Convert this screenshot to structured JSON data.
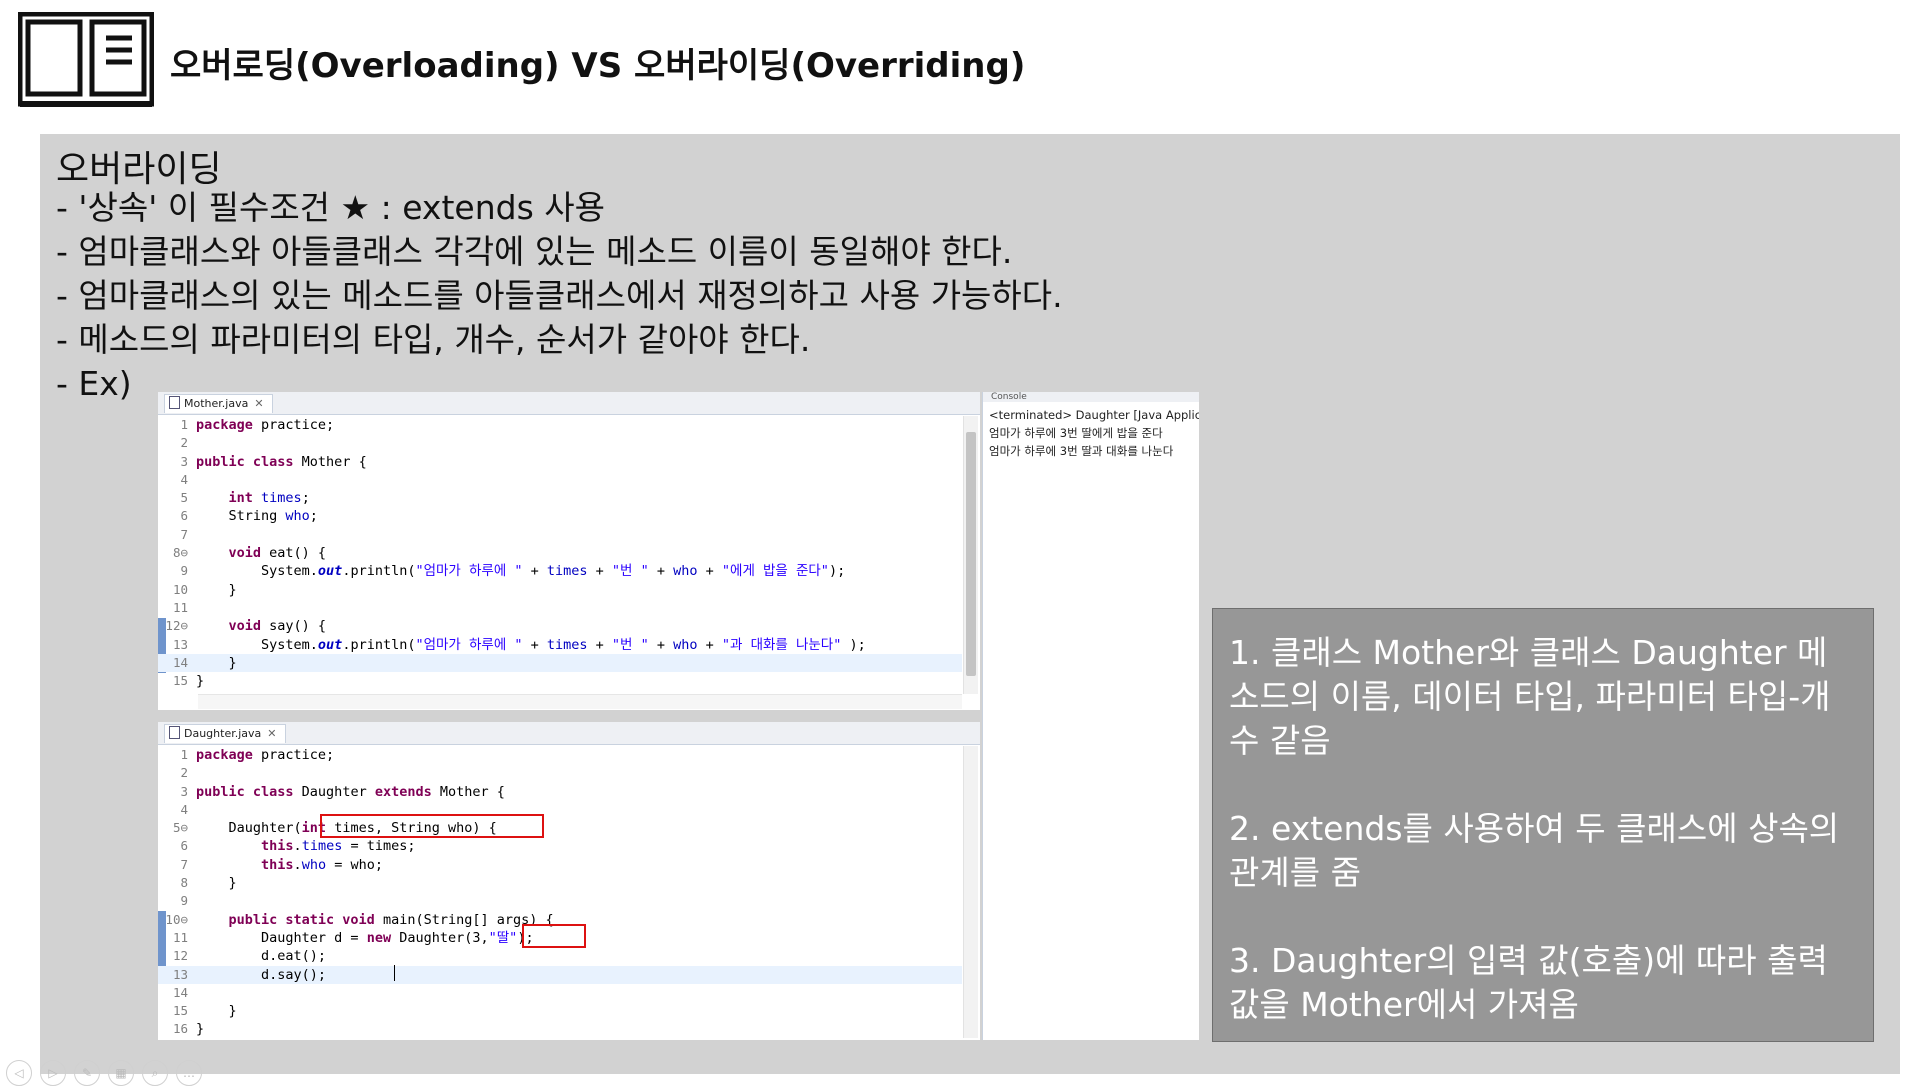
{
  "slide": {
    "title": "오버로딩(Overloading) VS 오버라이딩(Overriding)",
    "heading": "오버라이딩",
    "bullets": [
      "-  '상속' 이 필수조건 ★ : extends 사용",
      "- 엄마클래스와 아들클래스 각각에 있는 메소드 이름이 동일해야 한다.",
      "- 엄마클래스의 있는 메소드를 아들클래스에서 재정의하고 사용 가능하다.",
      "- 메소드의 파라미터의 타입, 개수, 순서가 같아야 한다.",
      "- Ex)"
    ]
  },
  "mother_editor": {
    "tab_label": "Mother.java",
    "lines": [
      {
        "n": "1",
        "html": "<span class=\"kw\">package</span> practice;"
      },
      {
        "n": "2",
        "html": ""
      },
      {
        "n": "3",
        "html": "<span class=\"kw\">public class</span> Mother {"
      },
      {
        "n": "4",
        "html": ""
      },
      {
        "n": "5",
        "html": "    <span class=\"kw\">int</span> <span class=\"fld\">times</span>;"
      },
      {
        "n": "6",
        "html": "    String <span class=\"fld\">who</span>;"
      },
      {
        "n": "7",
        "html": ""
      },
      {
        "n": "8⊖",
        "html": "    <span class=\"kw\">void</span> eat() {"
      },
      {
        "n": "9",
        "html": "        System.<span class=\"itl\">out</span>.println(<span class=\"str\">\"엄마가 하루에 \"</span> + <span class=\"fld\">times</span> + <span class=\"str\">\"번 \"</span> + <span class=\"fld\">who</span> + <span class=\"str\">\"에게 밥을 준다\"</span>);"
      },
      {
        "n": "10",
        "html": "    }"
      },
      {
        "n": "11",
        "html": ""
      },
      {
        "n": "12⊖",
        "html": "    <span class=\"kw\">void</span> say() {"
      },
      {
        "n": "13",
        "html": "        System.<span class=\"itl\">out</span>.println(<span class=\"str\">\"엄마가 하루에 \"</span> + <span class=\"fld\">times</span> + <span class=\"str\">\"번 \"</span> + <span class=\"fld\">who</span> + <span class=\"str\">\"과 대화를 나눈다\"</span> );"
      },
      {
        "n": "14",
        "html": "    }"
      },
      {
        "n": "15",
        "html": "}"
      }
    ]
  },
  "daughter_editor": {
    "tab_label": "Daughter.java",
    "lines": [
      {
        "n": "1",
        "html": "<span class=\"kw\">package</span> practice;"
      },
      {
        "n": "2",
        "html": ""
      },
      {
        "n": "3",
        "html": "<span class=\"kw\">public class</span> Daughter <span class=\"kw\">extends</span> Mother {"
      },
      {
        "n": "4",
        "html": ""
      },
      {
        "n": "5⊖",
        "html": "    Daughter(<span class=\"kw\">int</span> times, String who) {"
      },
      {
        "n": "6",
        "html": "        <span class=\"kw\">this</span>.<span class=\"fld\">times</span> = times;"
      },
      {
        "n": "7",
        "html": "        <span class=\"kw\">this</span>.<span class=\"fld\">who</span> = who;"
      },
      {
        "n": "8",
        "html": "    }"
      },
      {
        "n": "9",
        "html": ""
      },
      {
        "n": "10⊖",
        "html": "    <span class=\"kw\">public static void</span> main(String[] args) {"
      },
      {
        "n": "11",
        "html": "        Daughter d = <span class=\"kw\">new</span> Daughter(3,<span class=\"str\">\"딸\"</span>);"
      },
      {
        "n": "12",
        "html": "        d.eat();"
      },
      {
        "n": "13",
        "html": "        d.say();"
      },
      {
        "n": "14",
        "html": ""
      },
      {
        "n": "15",
        "html": "    }"
      },
      {
        "n": "16",
        "html": "}"
      }
    ]
  },
  "console": {
    "tab_label": "Console",
    "status": "<terminated> Daughter [Java Application]",
    "output": [
      "엄마가 하루에 3번 딸에게 밥을 준다",
      "엄마가 하루에 3번 딸과 대화를 나눈다"
    ]
  },
  "note": {
    "items": [
      "1. 클래스 Mother와 클래스 Daughter 메소드의 이름, 데이터 타입, 파라미터 타입-개수 같음",
      "2. extends를 사용하여 두 클래스에 상속의 관계를 줌",
      "3. Daughter의 입력 값(호출)에 따라 출력 값을 Mother에서 가져옴"
    ]
  },
  "icons": [
    "book-icon",
    "file-icon",
    "close-icon",
    "player-prev-icon",
    "player-play-icon",
    "player-pen-icon",
    "player-grid-icon",
    "player-zoom-icon",
    "player-more-icon"
  ]
}
